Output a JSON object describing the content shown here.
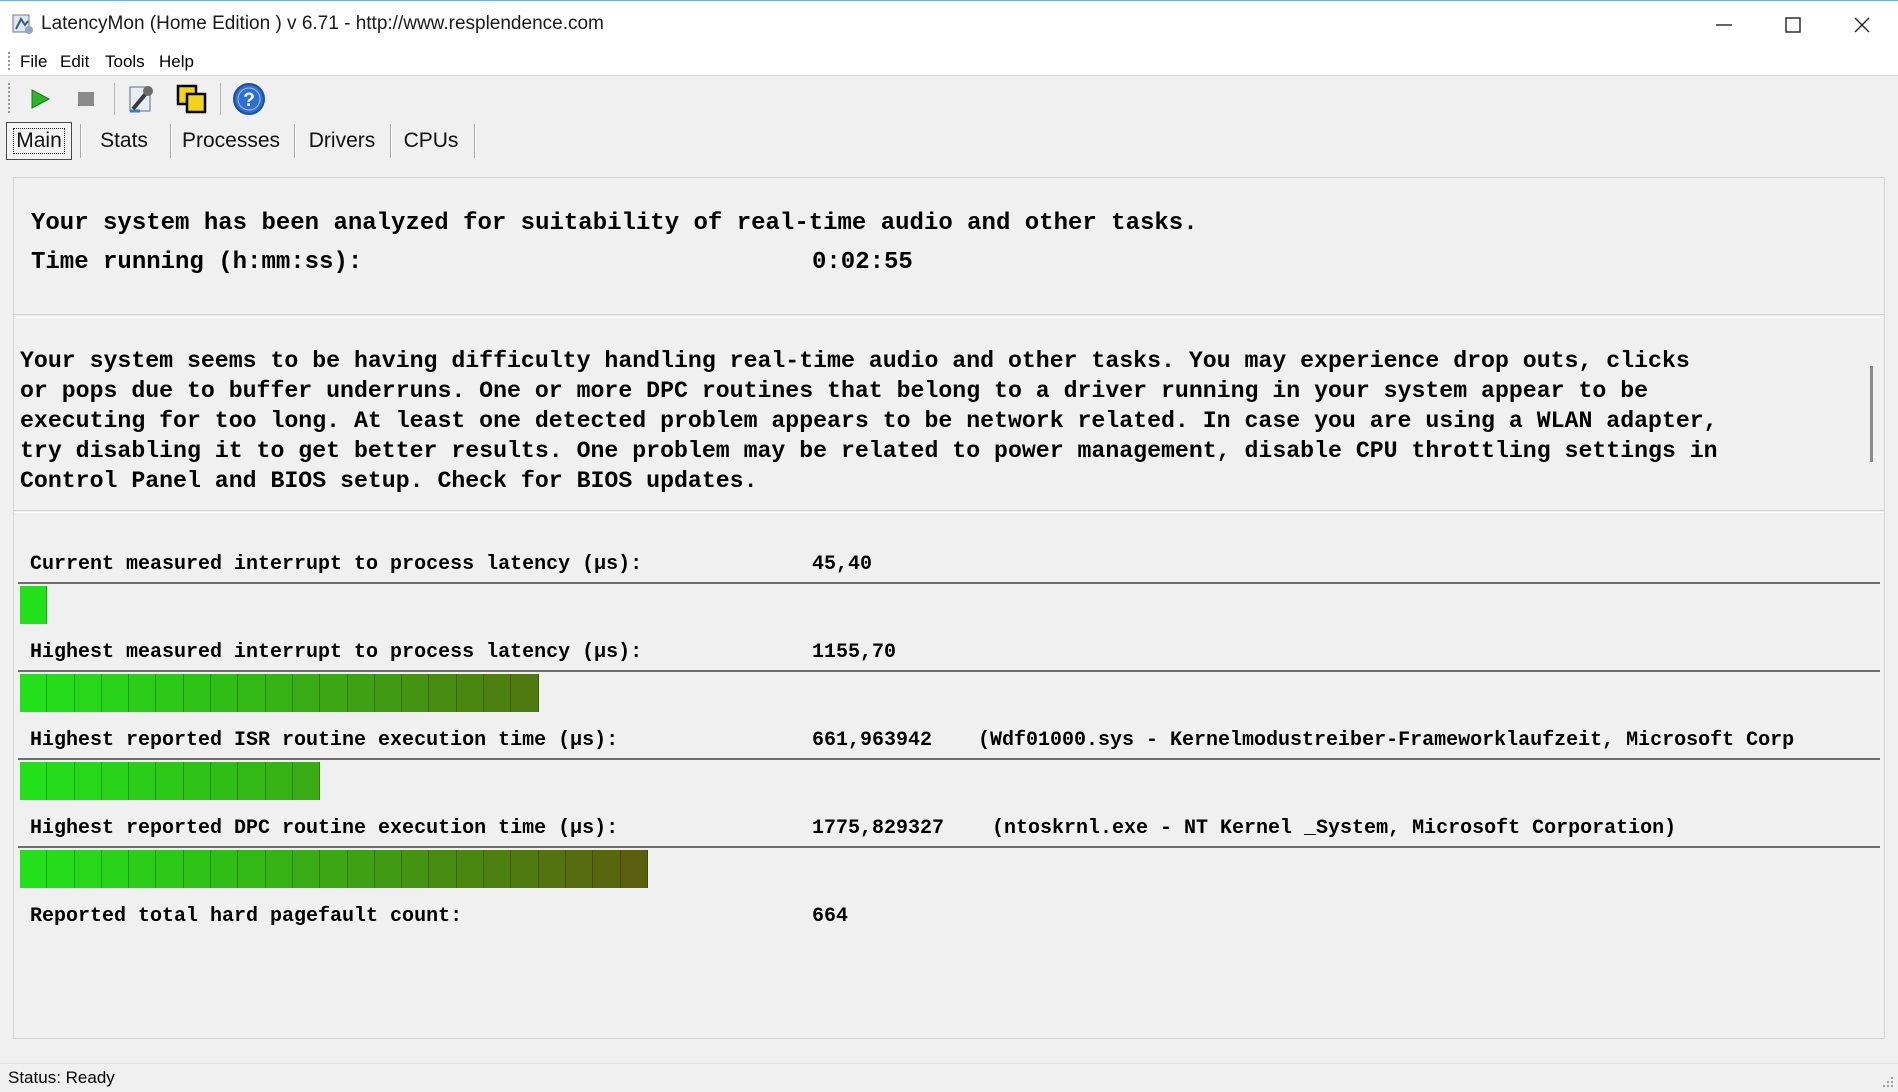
{
  "window": {
    "title": "LatencyMon  (Home Edition )  v 6.71 - http://www.resplendence.com"
  },
  "menu": [
    "File",
    "Edit",
    "Tools",
    "Help"
  ],
  "toolbar": {
    "icons": [
      "play-icon",
      "stop-icon",
      "wrench-icon",
      "copy-windows-icon",
      "help-icon"
    ]
  },
  "tabs": [
    "Main",
    "Stats",
    "Processes",
    "Drivers",
    "CPUs"
  ],
  "active_tab": "Main",
  "summary": {
    "analyzed": "Your system has been analyzed for suitability of real-time audio and other tasks.",
    "time_label": "Time running (h:mm:ss):",
    "time_value": "0:02:55"
  },
  "conclusion": [
    "Your system seems to be having difficulty handling real-time audio and other tasks. You may experience drop outs, clicks",
    "or pops due to buffer underruns. One or more DPC routines that belong to a driver running in your system appear to be",
    "executing for too long. At least one detected problem appears to be network related. In case you are using a WLAN adapter,",
    "try disabling it to get better results. One problem may be related to power management, disable CPU throttling settings in",
    "Control Panel and BIOS setup. Check for BIOS updates."
  ],
  "metrics": [
    {
      "label": "Current measured interrupt to process latency (µs):",
      "value": "45,40",
      "detail": "",
      "segments": 1
    },
    {
      "label": "Highest measured interrupt to process latency (µs):",
      "value": "1155,70",
      "detail": "",
      "segments": 19
    },
    {
      "label": "Highest reported ISR routine execution time (µs):",
      "value": "661,963942",
      "detail": "(Wdf01000.sys - Kernelmodustreiber-Frameworklaufzeit, Microsoft Corp",
      "segments": 11
    },
    {
      "label": "Highest reported DPC routine execution time (µs):",
      "value": "1775,829327",
      "detail": "(ntoskrnl.exe - NT Kernel _System, Microsoft Corporation)",
      "segments": 23
    }
  ],
  "pagefault": {
    "label": "Reported total hard pagefault count:",
    "value": "664"
  },
  "status": "Status: Ready",
  "colors": {
    "bar_green": "#22e01a",
    "bar_dark": "#6a3d0a",
    "titlebar": "#ffffff",
    "background": "#f0f0f0"
  }
}
